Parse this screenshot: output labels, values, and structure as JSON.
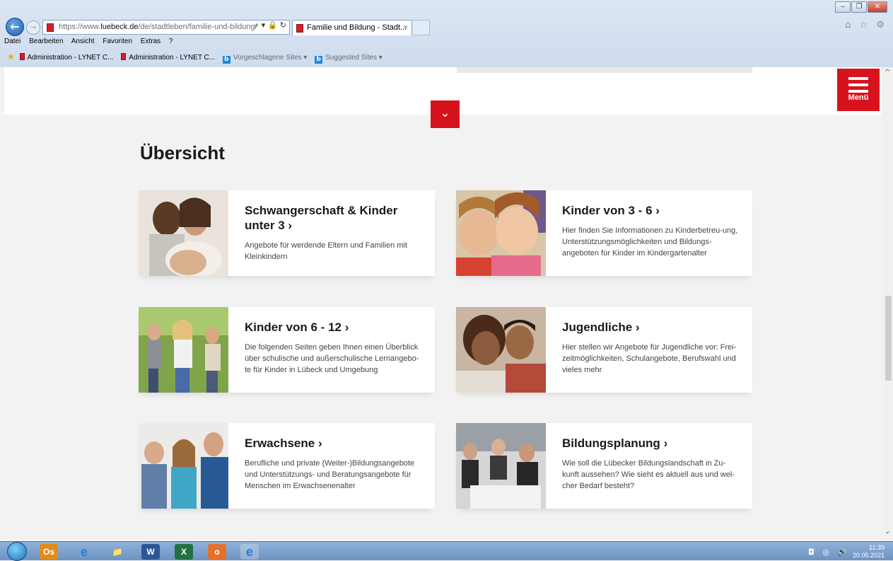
{
  "browser": {
    "url_prefix": "https://www.",
    "url_domain": "luebeck.de",
    "url_path": "/de/stadtleben/familie-und-bildung/",
    "address_tools": "⌕ ▾ 🔒 ↻",
    "tab_title": "Familie und Bildung - Stadt...",
    "tab_close": "×",
    "right_icons": "⌂ ☆ ⚙",
    "back": "←",
    "forward": "→",
    "window_controls": [
      "‒",
      "❐",
      "✕"
    ]
  },
  "menubar": [
    "Datei",
    "Bearbeiten",
    "Ansicht",
    "Favoriten",
    "Extras",
    "?"
  ],
  "favorites": [
    {
      "label": "Administration - LYNET C...",
      "icon": "red-page-icon"
    },
    {
      "label": "Administration - LYNET C...",
      "icon": "red-page-icon"
    },
    {
      "label": "Vorgeschlagene Sites ▾",
      "icon": "bing-icon"
    },
    {
      "label": "Suggested Sites ▾",
      "icon": "bing-icon"
    }
  ],
  "page": {
    "menu_label": "Menü",
    "dropdown_glyph": "⌄",
    "heading": "Übersicht",
    "cards": [
      {
        "title": "Schwangerschaft & Kinder unter 3",
        "arrow": "›",
        "desc": "Angebote für werdende Eltern und Familien mit Kleinkindern",
        "image": "pregnant-couple-image"
      },
      {
        "title": "Kinder von 3 - 6",
        "arrow": "›",
        "desc": "Hier finden Sie Informationen zu Kinderbetreu-ung, Unterstützungsmöglichkeiten und Bildungs-angeboten für Kinder im Kindergartenalter",
        "image": "young-children-image"
      },
      {
        "title": "Kinder von 6 - 12",
        "arrow": "›",
        "desc": "Die folgenden Seiten geben Ihnen einen Überblick über schulische und außerschulische Lernangebo-te für Kinder in Lübeck und Umgebung",
        "image": "school-children-image"
      },
      {
        "title": "Jugendliche",
        "arrow": "›",
        "desc": "Hier stellen wir Angebote für Jugendliche vor: Frei-zeitmöglichkeiten, Schulangebote, Berufswahl und vieles mehr",
        "image": "teenagers-image"
      },
      {
        "title": "Erwachsene",
        "arrow": "›",
        "desc": "Berufliche und private (Weiter-)Bildungsangebote und Unterstützungs- und Beratungsangebote für Menschen im Erwachsenenalter",
        "image": "adults-group-image"
      },
      {
        "title": "Bildungsplanung",
        "arrow": "›",
        "desc": "Wie soll die Lübecker Bildungslandschaft in Zu-kunft aussehen? Wie sieht es aktuell aus und wel-cher Bedarf besteht?",
        "image": "meeting-image"
      }
    ]
  },
  "taskbar": {
    "apps": [
      "Os",
      "e",
      "📁",
      "W",
      "X",
      "o",
      "e"
    ],
    "tray_icons": "◘ ◎ 🔊",
    "time": "11:39",
    "date": "20.05.2021"
  },
  "colors": {
    "accent": "#d6131d",
    "background": "#f2f2f2"
  }
}
